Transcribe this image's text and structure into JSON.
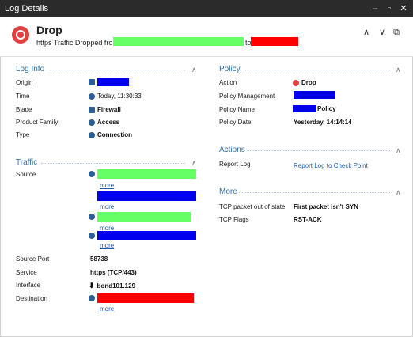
{
  "window": {
    "title": "Log Details",
    "controls": {
      "minimize": "–",
      "maximize": "▫",
      "close": "✕"
    }
  },
  "header": {
    "title": "Drop",
    "subtitle": "https Traffic Dropped from",
    "to": "to",
    "controls": {
      "up": "∧",
      "down": "∨",
      "copy": "⧉"
    },
    "colors": {
      "drop": "#e14040"
    }
  },
  "log_info": {
    "title": "Log Info",
    "rows": [
      {
        "label": "Origin",
        "value": ""
      },
      {
        "label": "Time",
        "value": "Today, 11:30:33"
      },
      {
        "label": "Blade",
        "value": "Firewall"
      },
      {
        "label": "Product Family",
        "value": "Access"
      },
      {
        "label": "Type",
        "value": "Connection"
      }
    ]
  },
  "traffic": {
    "title": "Traffic",
    "source_label": "Source",
    "more": "more",
    "rows": [
      {
        "label": "Source Port",
        "value": "58738"
      },
      {
        "label": "Service",
        "value": "https (TCP/443)"
      },
      {
        "label": "Interface",
        "value": "bond101.129"
      },
      {
        "label": "Destination",
        "value": ""
      }
    ]
  },
  "policy": {
    "title": "Policy",
    "rows": [
      {
        "label": "Action",
        "value": "Drop"
      },
      {
        "label": "Policy Management",
        "value": ""
      },
      {
        "label": "Policy Name",
        "value": "Policy"
      },
      {
        "label": "Policy Date",
        "value": "Yesterday, 14:14:14"
      }
    ]
  },
  "actions": {
    "title": "Actions",
    "report_label": "Report Log",
    "report_link": "Report Log to Check Point"
  },
  "more_section": {
    "title": "More",
    "rows": [
      {
        "label": "TCP packet out of state",
        "value": "First packet isn't SYN"
      },
      {
        "label": "TCP Flags",
        "value": "RST-ACK"
      }
    ]
  },
  "caret": "∧",
  "colors": {
    "accent": "#2f6ea6",
    "link": "#1d60b0",
    "redacted_green": "#66ff66",
    "redacted_red": "#ff0000",
    "redacted_blue": "#0000ee"
  }
}
